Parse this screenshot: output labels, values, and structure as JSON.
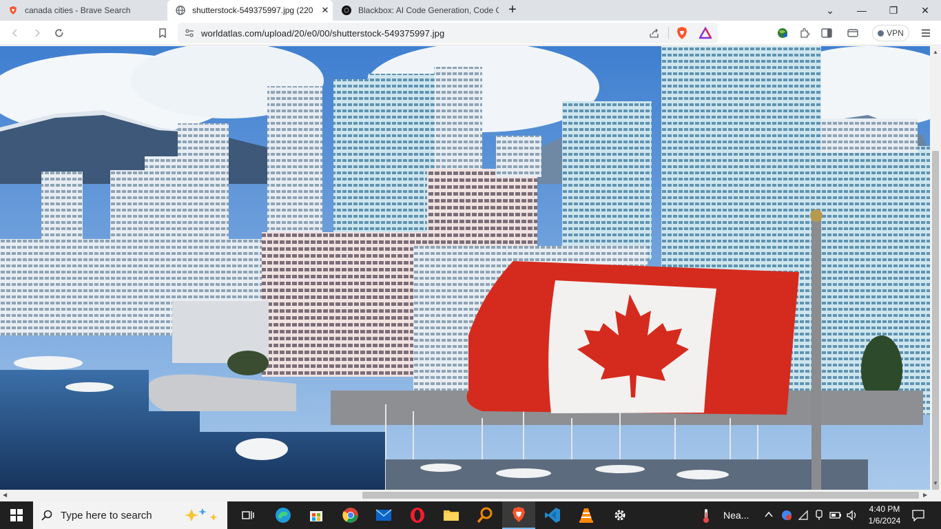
{
  "tabs": [
    {
      "title": "canada cities - Brave Search",
      "icon": "brave-search-icon",
      "active": false
    },
    {
      "title": "shutterstock-549375997.jpg (220",
      "icon": "globe-icon",
      "active": true
    },
    {
      "title": "Blackbox: AI Code Generation, Code C",
      "icon": "blackbox-icon",
      "active": false
    }
  ],
  "window": {
    "minimize": "—",
    "restore": "❐",
    "close": "✕",
    "dropdown": "⌄",
    "newtab": "+"
  },
  "toolbar": {
    "url": "worldatlas.com/upload/20/e0/00/shutterstock-549375997.jpg",
    "vpn_label": "VPN"
  },
  "content": {
    "image_description_alt": "Canadian flag in front of Vancouver skyline"
  },
  "taskbar": {
    "search_placeholder": "Type here to search",
    "weather_text": "Nea...",
    "time": "4:40 PM",
    "date": "1/6/2024"
  },
  "colors": {
    "flag_red": "#d52b1e",
    "taskbar_bg": "#202020",
    "tab_strip_bg": "#dee1e6",
    "brave_orange": "#fb542b"
  }
}
